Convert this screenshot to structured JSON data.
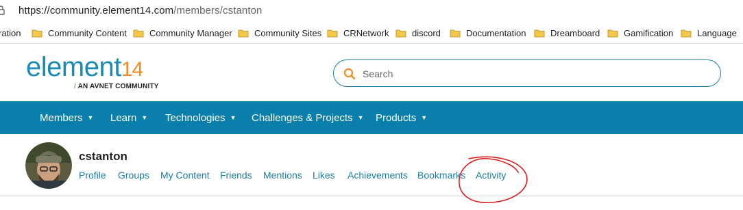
{
  "browser": {
    "url_main": "https://community.element14.com",
    "url_path": "/members/cstanton"
  },
  "bookmarks": [
    {
      "label": "ration",
      "has_folder": false
    },
    {
      "label": "Community Content",
      "has_folder": true
    },
    {
      "label": "Community Manager",
      "has_folder": true
    },
    {
      "label": "Community Sites",
      "has_folder": true
    },
    {
      "label": "CRNetwork",
      "has_folder": true
    },
    {
      "label": "discord",
      "has_folder": true
    },
    {
      "label": "Documentation",
      "has_folder": true
    },
    {
      "label": "Dreamboard",
      "has_folder": true
    },
    {
      "label": "Gamification",
      "has_folder": true
    },
    {
      "label": "Language",
      "has_folder": true
    }
  ],
  "header": {
    "logo_word": "element",
    "logo_num": "14",
    "logo_tagline": "AN AVNET COMMUNITY",
    "logo_slash": "/"
  },
  "search": {
    "placeholder": "Search"
  },
  "nav": {
    "items": [
      "Members",
      "Learn",
      "Technologies",
      "Challenges & Projects",
      "Products"
    ]
  },
  "profile": {
    "username": "cstanton",
    "tabs": [
      "Profile",
      "Groups",
      "My Content",
      "Friends",
      "Mentions",
      "Likes",
      "Achievements",
      "Bookmarks",
      "Activity"
    ]
  },
  "colors": {
    "brand_blue": "#0a7fac",
    "link_blue": "#1a7ea3",
    "logo_orange": "#f28b22",
    "annotation_red": "#d91c1c",
    "folder_yellow": "#f2c94c"
  }
}
